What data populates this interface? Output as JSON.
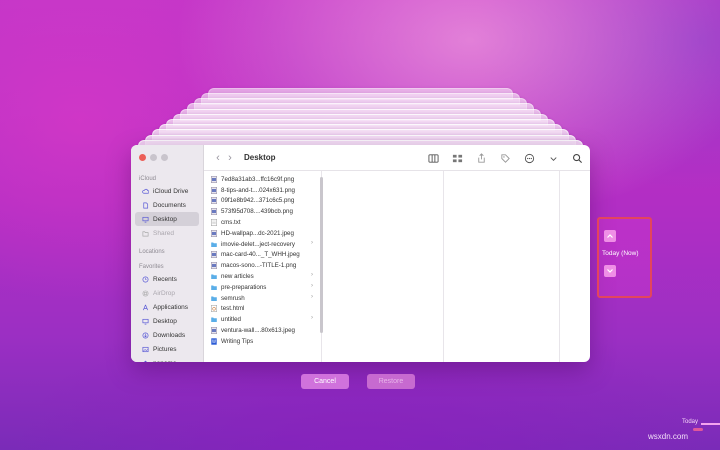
{
  "finder": {
    "title": "Desktop",
    "sidebar": {
      "sections": [
        {
          "label": "iCloud",
          "items": [
            {
              "label": "iCloud Drive",
              "icon": "cloud-icon",
              "selected": false,
              "dim": false
            },
            {
              "label": "Documents",
              "icon": "document-icon",
              "selected": false,
              "dim": false
            },
            {
              "label": "Desktop",
              "icon": "desktop-icon",
              "selected": true,
              "dim": false
            },
            {
              "label": "Shared",
              "icon": "shared-folder-icon",
              "selected": false,
              "dim": true
            }
          ]
        },
        {
          "label": "Locations",
          "items": []
        },
        {
          "label": "Favorites",
          "items": [
            {
              "label": "Recents",
              "icon": "clock-icon",
              "selected": false,
              "dim": false
            },
            {
              "label": "AirDrop",
              "icon": "airdrop-icon",
              "selected": false,
              "dim": true
            },
            {
              "label": "Applications",
              "icon": "applications-icon",
              "selected": false,
              "dim": false
            },
            {
              "label": "Desktop",
              "icon": "desktop-icon",
              "selected": false,
              "dim": false
            },
            {
              "label": "Downloads",
              "icon": "download-icon",
              "selected": false,
              "dim": false
            },
            {
              "label": "Pictures",
              "icon": "pictures-icon",
              "selected": false,
              "dim": false
            },
            {
              "label": "noname",
              "icon": "home-icon",
              "selected": false,
              "dim": false
            }
          ]
        }
      ]
    },
    "files": [
      {
        "name": "7ed8a31ab3...ffc16c9f.png",
        "kind": "image",
        "folder": false
      },
      {
        "name": "8-tips-and-t....024x631.png",
        "kind": "image",
        "folder": false
      },
      {
        "name": "09f1e8b942...371c6c5.png",
        "kind": "image",
        "folder": false
      },
      {
        "name": "573f95d708....439bcb.png",
        "kind": "image",
        "folder": false
      },
      {
        "name": "cms.txt",
        "kind": "text",
        "folder": false
      },
      {
        "name": "HD-wallpap...dc-2021.jpeg",
        "kind": "image",
        "folder": false
      },
      {
        "name": "imovie-delet...ject-recovery",
        "kind": "folder",
        "folder": true
      },
      {
        "name": "mac-card-40..._T_WHH.jpeg",
        "kind": "image",
        "folder": false
      },
      {
        "name": "macos-sono...-TITLE-1.png",
        "kind": "image",
        "folder": false
      },
      {
        "name": "new articles",
        "kind": "folder",
        "folder": true
      },
      {
        "name": "pre-preparations",
        "kind": "folder",
        "folder": true
      },
      {
        "name": "semrush",
        "kind": "folder",
        "folder": true
      },
      {
        "name": "test.html",
        "kind": "html",
        "folder": false
      },
      {
        "name": "untitled",
        "kind": "folder",
        "folder": true
      },
      {
        "name": "ventura-wall....80x613.jpeg",
        "kind": "image",
        "folder": false
      },
      {
        "name": "Writing Tips",
        "kind": "doc",
        "folder": false
      }
    ]
  },
  "timenav": {
    "label": "Today (Now)"
  },
  "buttons": {
    "cancel": "Cancel",
    "restore": "Restore"
  },
  "timeline": {
    "label": "Today"
  },
  "watermark": "wsxdn.com",
  "colors": {
    "accent": "#e3455d",
    "folder": "#5aaee8",
    "button": "#d072dc"
  }
}
